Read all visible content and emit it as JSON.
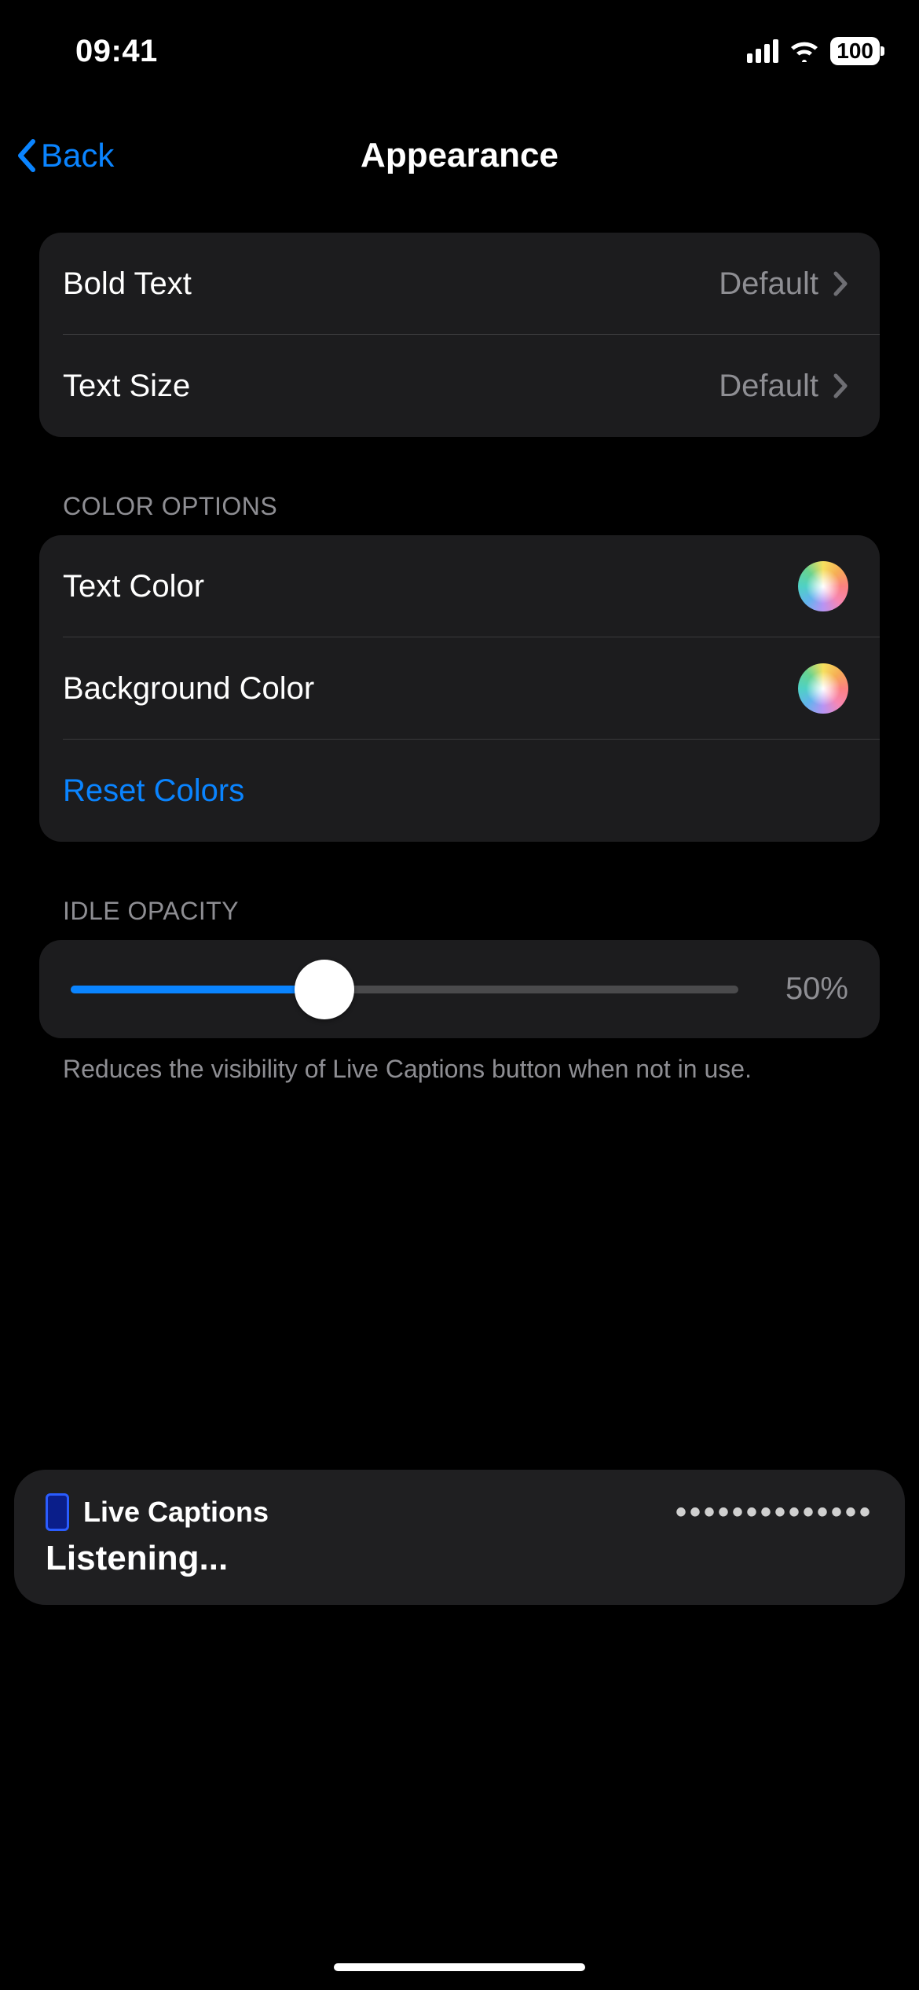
{
  "status": {
    "time": "09:41",
    "battery": "100"
  },
  "nav": {
    "back_label": "Back",
    "title": "Appearance"
  },
  "text_group": {
    "bold_text": {
      "label": "Bold Text",
      "value": "Default"
    },
    "text_size": {
      "label": "Text Size",
      "value": "Default"
    }
  },
  "color_group": {
    "header": "COLOR OPTIONS",
    "text_color": {
      "label": "Text Color"
    },
    "background_color": {
      "label": "Background Color"
    },
    "reset": {
      "label": "Reset Colors"
    }
  },
  "opacity_group": {
    "header": "IDLE OPACITY",
    "value_pct": 50,
    "value_display": "50%",
    "footer": "Reduces the visibility of Live Captions button when not in use."
  },
  "live_captions": {
    "title": "Live Captions",
    "dots": "••••••••••••••",
    "status": "Listening..."
  }
}
